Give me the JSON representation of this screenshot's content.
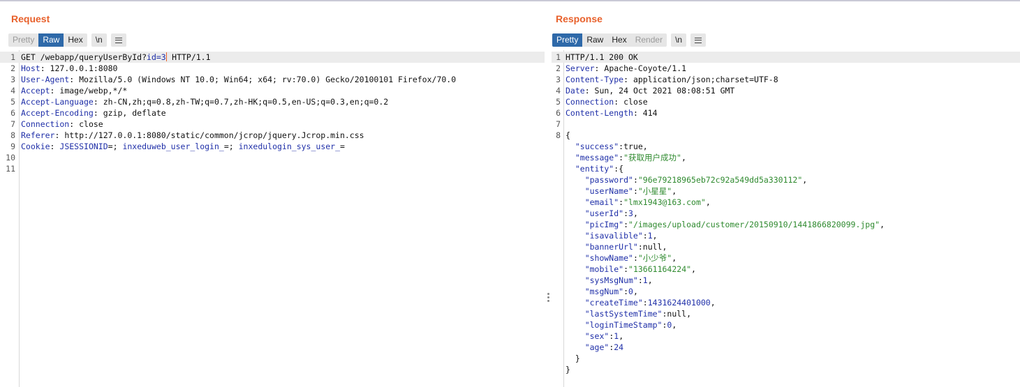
{
  "request": {
    "title": "Request",
    "tabs": [
      {
        "label": "Pretty",
        "state": "disabled"
      },
      {
        "label": "Raw",
        "state": "active"
      },
      {
        "label": "Hex",
        "state": "normal"
      }
    ],
    "newline_button": "\\n",
    "menu_icon": "hamburger-menu-icon",
    "lines": [
      [
        {
          "t": "GET /webapp/queryUserById?"
        },
        {
          "t": "id=3",
          "c": "k"
        },
        {
          "caret": true
        },
        {
          "t": " HTTP/1.1"
        }
      ],
      [
        {
          "t": "Host",
          "c": "k"
        },
        {
          "t": ": 127.0.0.1:8080"
        }
      ],
      [
        {
          "t": "User-Agent",
          "c": "k"
        },
        {
          "t": ": Mozilla/5.0 (Windows NT 10.0; Win64; x64; rv:70.0) Gecko/20100101 Firefox/70.0"
        }
      ],
      [
        {
          "t": "Accept",
          "c": "k"
        },
        {
          "t": ": image/webp,*/*"
        }
      ],
      [
        {
          "t": "Accept-Language",
          "c": "k"
        },
        {
          "t": ": zh-CN,zh;q=0.8,zh-TW;q=0.7,zh-HK;q=0.5,en-US;q=0.3,en;q=0.2"
        }
      ],
      [
        {
          "t": "Accept-Encoding",
          "c": "k"
        },
        {
          "t": ": gzip, deflate"
        }
      ],
      [
        {
          "t": "Connection",
          "c": "k"
        },
        {
          "t": ": close"
        }
      ],
      [
        {
          "t": "Referer",
          "c": "k"
        },
        {
          "t": ": http://127.0.0.1:8080/static/common/jcrop/jquery.Jcrop.min.css"
        }
      ],
      [
        {
          "t": "Cookie",
          "c": "k"
        },
        {
          "t": ": "
        },
        {
          "t": "JSESSIONID",
          "c": "k"
        },
        {
          "t": "=; "
        },
        {
          "t": "inxeduweb_user_login_",
          "c": "k"
        },
        {
          "t": "=; "
        },
        {
          "t": "inxedulogin_sys_user_",
          "c": "k"
        },
        {
          "t": "="
        }
      ],
      [],
      []
    ]
  },
  "response": {
    "title": "Response",
    "tabs": [
      {
        "label": "Pretty",
        "state": "active"
      },
      {
        "label": "Raw",
        "state": "normal"
      },
      {
        "label": "Hex",
        "state": "normal"
      },
      {
        "label": "Render",
        "state": "disabled"
      }
    ],
    "newline_button": "\\n",
    "menu_icon": "hamburger-menu-icon",
    "lines": [
      {
        "num": "1",
        "parts": [
          {
            "t": "HTTP/1.1 200 OK"
          }
        ]
      },
      {
        "num": "2",
        "parts": [
          {
            "t": "Server",
            "c": "k"
          },
          {
            "t": ": Apache-Coyote/1.1"
          }
        ]
      },
      {
        "num": "3",
        "parts": [
          {
            "t": "Content-Type",
            "c": "k"
          },
          {
            "t": ": application/json;charset=UTF-8"
          }
        ]
      },
      {
        "num": "4",
        "parts": [
          {
            "t": "Date",
            "c": "k"
          },
          {
            "t": ": Sun, 24 Oct 2021 08:08:51 GMT"
          }
        ]
      },
      {
        "num": "5",
        "parts": [
          {
            "t": "Connection",
            "c": "k"
          },
          {
            "t": ": close"
          }
        ]
      },
      {
        "num": "6",
        "parts": [
          {
            "t": "Content-Length",
            "c": "k"
          },
          {
            "t": ": 414"
          }
        ]
      },
      {
        "num": "7",
        "parts": []
      },
      {
        "num": "8",
        "parts": [
          {
            "t": "{"
          }
        ]
      },
      {
        "num": "",
        "parts": [
          {
            "t": "  \"success\"",
            "c": "k"
          },
          {
            "t": ":true,"
          }
        ]
      },
      {
        "num": "",
        "parts": [
          {
            "t": "  \"message\"",
            "c": "k"
          },
          {
            "t": ":"
          },
          {
            "t": "\"获取用户成功\"",
            "c": "s"
          },
          {
            "t": ","
          }
        ]
      },
      {
        "num": "",
        "parts": [
          {
            "t": "  \"entity\"",
            "c": "k"
          },
          {
            "t": ":{"
          }
        ]
      },
      {
        "num": "",
        "parts": [
          {
            "t": "    \"password\"",
            "c": "k"
          },
          {
            "t": ":"
          },
          {
            "t": "\"96e79218965eb72c92a549dd5a330112\"",
            "c": "s"
          },
          {
            "t": ","
          }
        ]
      },
      {
        "num": "",
        "parts": [
          {
            "t": "    \"userName\"",
            "c": "k"
          },
          {
            "t": ":"
          },
          {
            "t": "\"小星星\"",
            "c": "s"
          },
          {
            "t": ","
          }
        ]
      },
      {
        "num": "",
        "parts": [
          {
            "t": "    \"email\"",
            "c": "k"
          },
          {
            "t": ":"
          },
          {
            "t": "\"lmx1943@163.com\"",
            "c": "s"
          },
          {
            "t": ","
          }
        ]
      },
      {
        "num": "",
        "parts": [
          {
            "t": "    \"userId\"",
            "c": "k"
          },
          {
            "t": ":"
          },
          {
            "t": "3",
            "c": "n"
          },
          {
            "t": ","
          }
        ]
      },
      {
        "num": "",
        "parts": [
          {
            "t": "    \"picImg\"",
            "c": "k"
          },
          {
            "t": ":"
          },
          {
            "t": "\"/images/upload/customer/20150910/1441866820099.jpg\"",
            "c": "s"
          },
          {
            "t": ","
          }
        ]
      },
      {
        "num": "",
        "parts": [
          {
            "t": "    \"isavalible\"",
            "c": "k"
          },
          {
            "t": ":"
          },
          {
            "t": "1",
            "c": "n"
          },
          {
            "t": ","
          }
        ]
      },
      {
        "num": "",
        "parts": [
          {
            "t": "    \"bannerUrl\"",
            "c": "k"
          },
          {
            "t": ":null,"
          }
        ]
      },
      {
        "num": "",
        "parts": [
          {
            "t": "    \"showName\"",
            "c": "k"
          },
          {
            "t": ":"
          },
          {
            "t": "\"小少爷\"",
            "c": "s"
          },
          {
            "t": ","
          }
        ]
      },
      {
        "num": "",
        "parts": [
          {
            "t": "    \"mobile\"",
            "c": "k"
          },
          {
            "t": ":"
          },
          {
            "t": "\"13661164224\"",
            "c": "s"
          },
          {
            "t": ","
          }
        ]
      },
      {
        "num": "",
        "parts": [
          {
            "t": "    \"sysMsgNum\"",
            "c": "k"
          },
          {
            "t": ":"
          },
          {
            "t": "1",
            "c": "n"
          },
          {
            "t": ","
          }
        ]
      },
      {
        "num": "",
        "parts": [
          {
            "t": "    \"msgNum\"",
            "c": "k"
          },
          {
            "t": ":"
          },
          {
            "t": "0",
            "c": "n"
          },
          {
            "t": ","
          }
        ]
      },
      {
        "num": "",
        "parts": [
          {
            "t": "    \"createTime\"",
            "c": "k"
          },
          {
            "t": ":"
          },
          {
            "t": "1431624401000",
            "c": "n"
          },
          {
            "t": ","
          }
        ]
      },
      {
        "num": "",
        "parts": [
          {
            "t": "    \"lastSystemTime\"",
            "c": "k"
          },
          {
            "t": ":null,"
          }
        ]
      },
      {
        "num": "",
        "parts": [
          {
            "t": "    \"loginTimeStamp\"",
            "c": "k"
          },
          {
            "t": ":"
          },
          {
            "t": "0",
            "c": "n"
          },
          {
            "t": ","
          }
        ]
      },
      {
        "num": "",
        "parts": [
          {
            "t": "    \"sex\"",
            "c": "k"
          },
          {
            "t": ":"
          },
          {
            "t": "1",
            "c": "n"
          },
          {
            "t": ","
          }
        ]
      },
      {
        "num": "",
        "parts": [
          {
            "t": "    \"age\"",
            "c": "k"
          },
          {
            "t": ":"
          },
          {
            "t": "24",
            "c": "n"
          }
        ]
      },
      {
        "num": "",
        "parts": [
          {
            "t": "  }"
          }
        ]
      },
      {
        "num": "",
        "parts": [
          {
            "t": "}"
          }
        ]
      }
    ]
  },
  "colors": {
    "accent": "#e8612c",
    "active_tab": "#2e69a9",
    "header_key": "#1f2fa8",
    "string": "#2f8a2f"
  }
}
